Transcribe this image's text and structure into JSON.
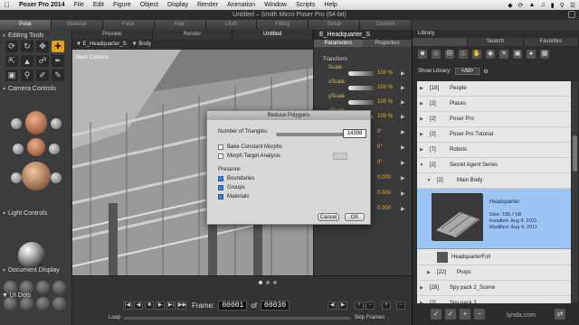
{
  "menubar": {
    "items": [
      "Poser Pro 2014",
      "File",
      "Edit",
      "Figure",
      "Object",
      "Display",
      "Render",
      "Animation",
      "Window",
      "Scripts",
      "Help"
    ]
  },
  "window": {
    "title": "Untitled – Smith Micro Poser Pro  (64-bit)"
  },
  "rooms": [
    "Pose",
    "Material",
    "Face",
    "Hair",
    "Cloth",
    "Fitting",
    "Setup",
    "Content"
  ],
  "left": {
    "editing_tools": "Editing Tools",
    "camera_controls": "Camera Controls",
    "light_controls": "Light Controls",
    "document_display": "Document Display",
    "ui_dots": "UI Dots"
  },
  "viewport": {
    "tabs": [
      "Preview",
      "Render",
      "Untitled"
    ],
    "figure_select": "E_Headquarter_S",
    "actor_select": "Body",
    "camera_label": "Main Camera"
  },
  "dialog": {
    "title": "Reduce Polygons",
    "triangles_label": "Number of Triangles:",
    "triangles_value": "14398",
    "bake_label": "Bake Constant Morphs",
    "morph_label": "Morph Target Analysis",
    "preserve_label": "Preserve:",
    "boundaries_label": "Boundaries",
    "groups_label": "Groups",
    "materials_label": "Materials",
    "cancel": "Cancel",
    "ok": "OK"
  },
  "params": {
    "figure": "E_Headquarter_S",
    "tabs": [
      "Parameters",
      "Properties"
    ],
    "group": "Transform",
    "rows": [
      {
        "name": "Scale",
        "value": "100 %"
      },
      {
        "name": "xScale",
        "value": "100 %"
      },
      {
        "name": "yScale",
        "value": "100 %"
      },
      {
        "name": "zScale",
        "value": "100 %"
      },
      {
        "name": "",
        "value": "0°"
      },
      {
        "name": "",
        "value": "0°"
      },
      {
        "name": "",
        "value": "0°"
      },
      {
        "name": "",
        "value": "0.000"
      },
      {
        "name": "",
        "value": "0.000"
      },
      {
        "name": "",
        "value": "0.000"
      }
    ]
  },
  "timeline": {
    "frame_label": "Frame:",
    "frame_current": "00001",
    "of_label": "of",
    "frame_total": "00030",
    "loop_label": "Loop",
    "skip_label": "Skip Frames"
  },
  "library": {
    "title": "Library",
    "tabs": [
      "Search",
      "Favorites"
    ],
    "show_label": "Show Library:",
    "show_value": "<All>",
    "rows": [
      {
        "count": "[18]",
        "label": "People",
        "sub": false
      },
      {
        "count": "[2]",
        "label": "Places",
        "sub": false
      },
      {
        "count": "[2]",
        "label": "Poser Pro",
        "sub": false
      },
      {
        "count": "[2]",
        "label": "Poser Pro Tutorial",
        "sub": false
      },
      {
        "count": "[7]",
        "label": "Robots",
        "sub": false
      },
      {
        "count": "[2]",
        "label": "Secret Agent Series",
        "sub": false,
        "open": true
      },
      {
        "count": "[2]",
        "label": "Main Body",
        "sub": true,
        "open": true
      }
    ],
    "selected": {
      "name": "Headquarter",
      "size": "Size: 156.7 kB",
      "installed": "Installed: Aug 4, 2011",
      "modified": "Modified: Aug 4, 2011"
    },
    "sub_item": "HeadquarterFull",
    "rows_after": [
      {
        "count": "[22]",
        "label": "Props",
        "sub": true
      },
      {
        "count": "[28]",
        "label": "Spy pack 2_Scene",
        "sub": false
      },
      {
        "count": "[2]",
        "label": "Spy pack 3",
        "sub": false
      }
    ]
  },
  "watermark": "lynda.com"
}
